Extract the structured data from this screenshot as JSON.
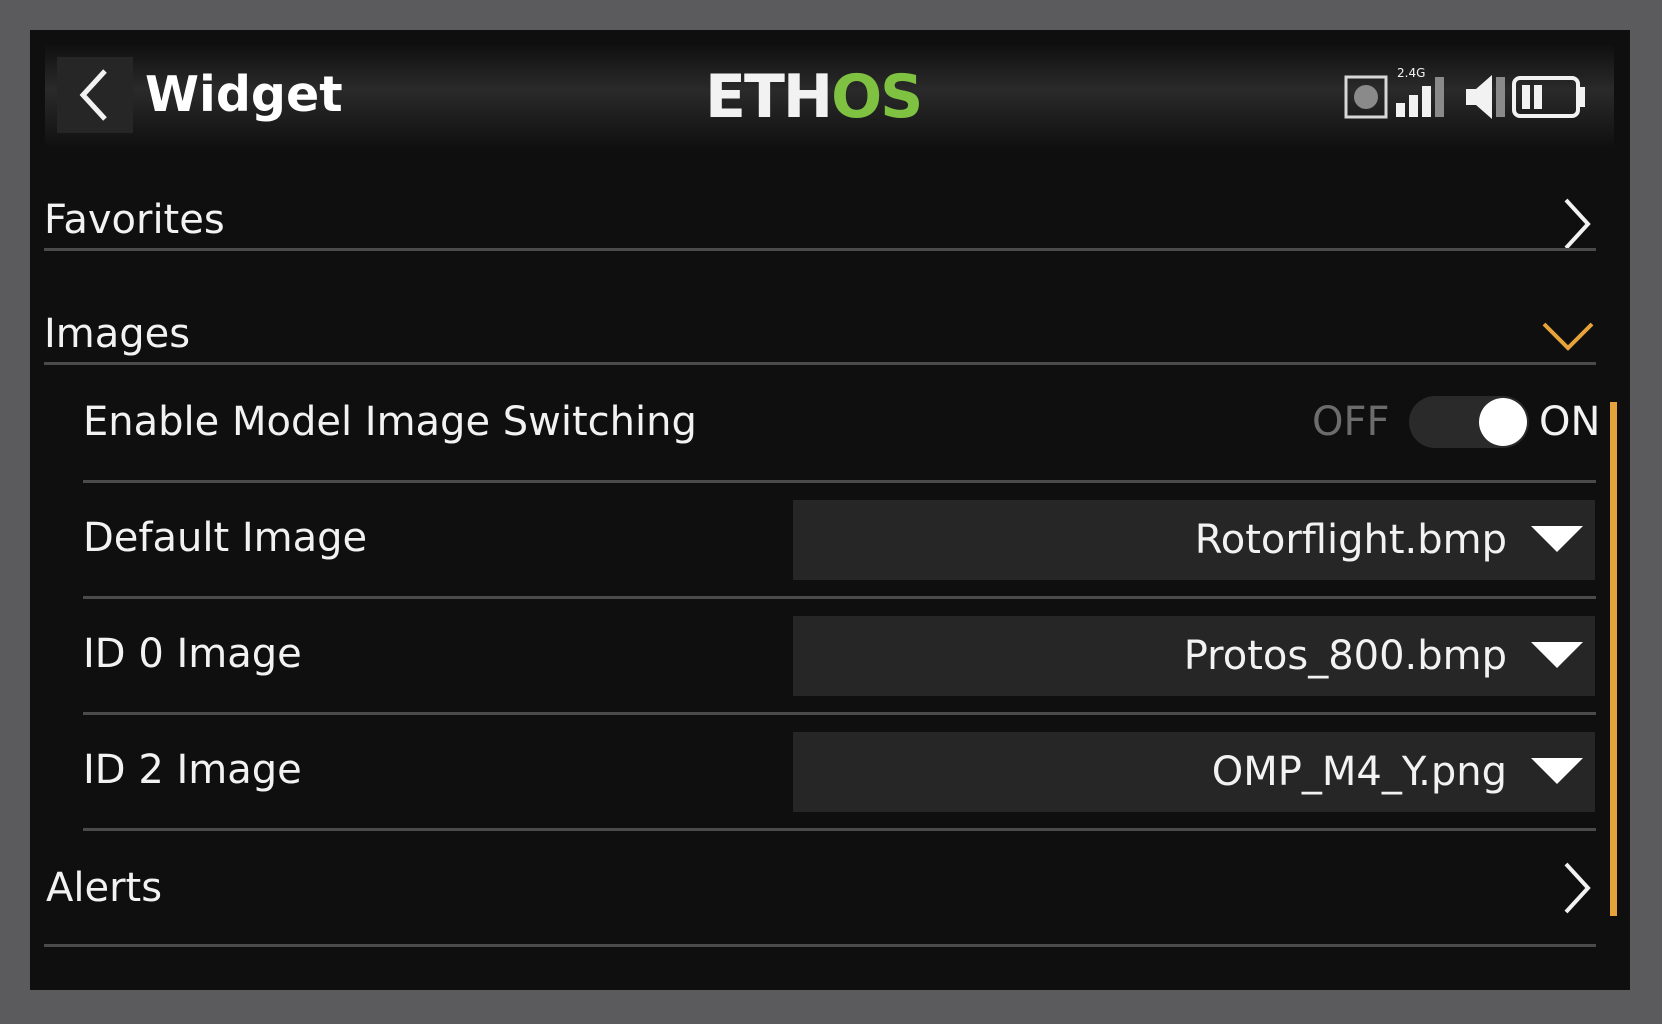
{
  "header": {
    "title": "Widget",
    "logo_left": "ETH",
    "logo_right": "OS",
    "logo_colors": {
      "left": "#f2f2f2",
      "right": "#7fc242"
    },
    "radio_band": "2.4G",
    "back_icon": "chevron-left-icon"
  },
  "sections": {
    "favorites": {
      "label": "Favorites",
      "icon": "chevron-right-icon"
    },
    "images": {
      "label": "Images",
      "icon": "chevron-down-icon",
      "icon_color": "#e7a33b",
      "expanded": true
    },
    "alerts": {
      "label": "Alerts",
      "icon": "chevron-right-icon"
    }
  },
  "image_settings": {
    "switching": {
      "label": "Enable Model Image Switching",
      "off_label": "OFF",
      "on_label": "ON",
      "value": "ON"
    },
    "default_image": {
      "label": "Default Image",
      "value": "Rotorflight.bmp"
    },
    "id0_image": {
      "label": "ID 0 Image",
      "value": "Protos_800.bmp"
    },
    "id2_image": {
      "label": "ID 2 Image",
      "value": "OMP_M4_Y.png"
    }
  },
  "accent_color": "#e7a33b"
}
